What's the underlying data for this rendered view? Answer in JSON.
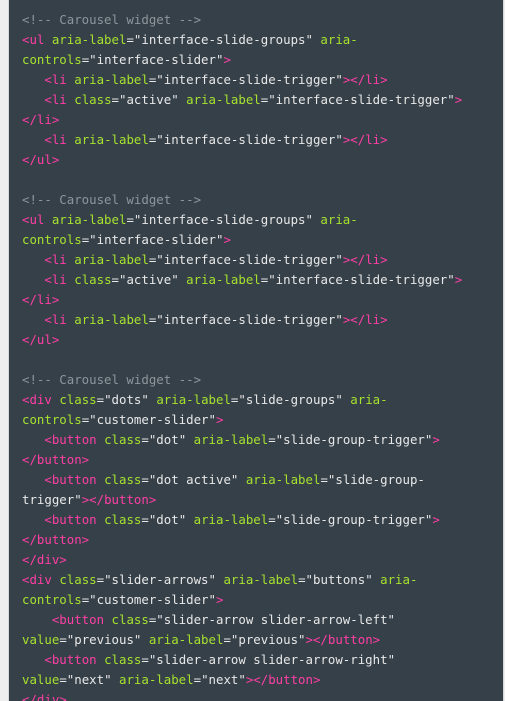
{
  "lines": [
    [
      [
        "c",
        "<!-- Carousel widget -->"
      ]
    ],
    [
      [
        "t",
        "<ul "
      ],
      [
        "a",
        "aria-label"
      ],
      [
        "s",
        "=\"interface-slide-groups\" "
      ],
      [
        "a",
        "aria-"
      ]
    ],
    [
      [
        "a",
        "controls"
      ],
      [
        "s",
        "=\"interface-slider\""
      ],
      [
        "t",
        ">"
      ]
    ],
    [
      [
        "s",
        "   "
      ],
      [
        "t",
        "<li "
      ],
      [
        "a",
        "aria-label"
      ],
      [
        "s",
        "=\"interface-slide-trigger\""
      ],
      [
        "t",
        "></li>"
      ]
    ],
    [
      [
        "s",
        "   "
      ],
      [
        "t",
        "<li "
      ],
      [
        "a",
        "class"
      ],
      [
        "s",
        "=\"active\" "
      ],
      [
        "a",
        "aria-label"
      ],
      [
        "s",
        "=\"interface-slide-trigger\""
      ],
      [
        "t",
        ">"
      ]
    ],
    [
      [
        "t",
        "</li>"
      ]
    ],
    [
      [
        "s",
        "   "
      ],
      [
        "t",
        "<li "
      ],
      [
        "a",
        "aria-label"
      ],
      [
        "s",
        "=\"interface-slide-trigger\""
      ],
      [
        "t",
        "></li>"
      ]
    ],
    [
      [
        "t",
        "</ul>"
      ]
    ],
    [],
    [
      [
        "c",
        "<!-- Carousel widget -->"
      ]
    ],
    [
      [
        "t",
        "<ul "
      ],
      [
        "a",
        "aria-label"
      ],
      [
        "s",
        "=\"interface-slide-groups\" "
      ],
      [
        "a",
        "aria-"
      ]
    ],
    [
      [
        "a",
        "controls"
      ],
      [
        "s",
        "=\"interface-slider\""
      ],
      [
        "t",
        ">"
      ]
    ],
    [
      [
        "s",
        "   "
      ],
      [
        "t",
        "<li "
      ],
      [
        "a",
        "aria-label"
      ],
      [
        "s",
        "=\"interface-slide-trigger\""
      ],
      [
        "t",
        "></li>"
      ]
    ],
    [
      [
        "s",
        "   "
      ],
      [
        "t",
        "<li "
      ],
      [
        "a",
        "class"
      ],
      [
        "s",
        "=\"active\" "
      ],
      [
        "a",
        "aria-label"
      ],
      [
        "s",
        "=\"interface-slide-trigger\""
      ],
      [
        "t",
        ">"
      ]
    ],
    [
      [
        "t",
        "</li>"
      ]
    ],
    [
      [
        "s",
        "   "
      ],
      [
        "t",
        "<li "
      ],
      [
        "a",
        "aria-label"
      ],
      [
        "s",
        "=\"interface-slide-trigger\""
      ],
      [
        "t",
        "></li>"
      ]
    ],
    [
      [
        "t",
        "</ul>"
      ]
    ],
    [],
    [
      [
        "c",
        "<!-- Carousel widget -->"
      ]
    ],
    [
      [
        "t",
        "<div "
      ],
      [
        "a",
        "class"
      ],
      [
        "s",
        "=\"dots\" "
      ],
      [
        "a",
        "aria-label"
      ],
      [
        "s",
        "=\"slide-groups\" "
      ],
      [
        "a",
        "aria-"
      ]
    ],
    [
      [
        "a",
        "controls"
      ],
      [
        "s",
        "=\"customer-slider\""
      ],
      [
        "t",
        ">"
      ]
    ],
    [
      [
        "s",
        "   "
      ],
      [
        "t",
        "<button "
      ],
      [
        "a",
        "class"
      ],
      [
        "s",
        "=\"dot\" "
      ],
      [
        "a",
        "aria-label"
      ],
      [
        "s",
        "=\"slide-group-trigger\""
      ],
      [
        "t",
        ">"
      ]
    ],
    [
      [
        "t",
        "</button>"
      ]
    ],
    [
      [
        "s",
        "   "
      ],
      [
        "t",
        "<button "
      ],
      [
        "a",
        "class"
      ],
      [
        "s",
        "=\"dot active\" "
      ],
      [
        "a",
        "aria-label"
      ],
      [
        "s",
        "=\"slide-group-"
      ]
    ],
    [
      [
        "s",
        "trigger\""
      ],
      [
        "t",
        "></button>"
      ]
    ],
    [
      [
        "s",
        "   "
      ],
      [
        "t",
        "<button "
      ],
      [
        "a",
        "class"
      ],
      [
        "s",
        "=\"dot\" "
      ],
      [
        "a",
        "aria-label"
      ],
      [
        "s",
        "=\"slide-group-trigger\""
      ],
      [
        "t",
        ">"
      ]
    ],
    [
      [
        "t",
        "</button>"
      ]
    ],
    [
      [
        "t",
        "</div>"
      ]
    ],
    [
      [
        "t",
        "<div "
      ],
      [
        "a",
        "class"
      ],
      [
        "s",
        "=\"slider-arrows\" "
      ],
      [
        "a",
        "aria-label"
      ],
      [
        "s",
        "=\"buttons\" "
      ],
      [
        "a",
        "aria-"
      ]
    ],
    [
      [
        "a",
        "controls"
      ],
      [
        "s",
        "=\"customer-slider\""
      ],
      [
        "t",
        ">"
      ]
    ],
    [
      [
        "s",
        "    "
      ],
      [
        "t",
        "<button "
      ],
      [
        "a",
        "class"
      ],
      [
        "s",
        "=\"slider-arrow slider-arrow-left\""
      ]
    ],
    [
      [
        "a",
        "value"
      ],
      [
        "s",
        "=\"previous\" "
      ],
      [
        "a",
        "aria-label"
      ],
      [
        "s",
        "=\"previous\""
      ],
      [
        "t",
        "></button>"
      ]
    ],
    [
      [
        "s",
        "   "
      ],
      [
        "t",
        "<button "
      ],
      [
        "a",
        "class"
      ],
      [
        "s",
        "=\"slider-arrow slider-arrow-right\""
      ]
    ],
    [
      [
        "a",
        "value"
      ],
      [
        "s",
        "=\"next\" "
      ],
      [
        "a",
        "aria-label"
      ],
      [
        "s",
        "=\"next\""
      ],
      [
        "t",
        "></button>"
      ]
    ],
    [
      [
        "t",
        "</div>"
      ]
    ]
  ]
}
